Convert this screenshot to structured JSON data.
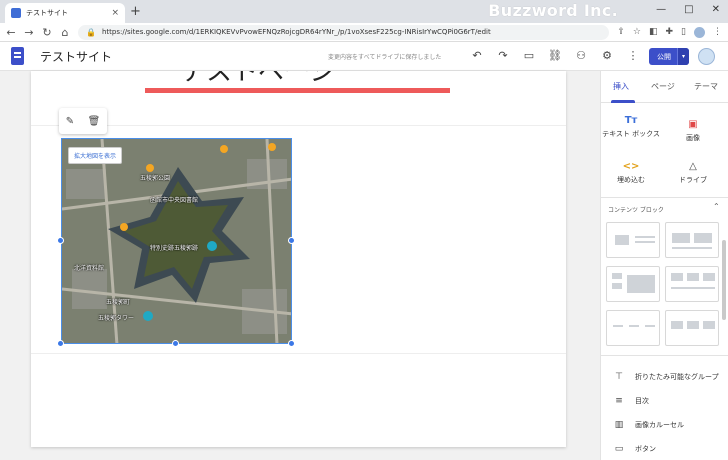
{
  "browser": {
    "tab_title": "テストサイト",
    "tab_close": "×",
    "new_tab": "+",
    "url": "https://sites.google.com/d/1ERKIQKEVvPvowEFNQzRojcgDR64rYNr_/p/1voXsesF225cg-INRisIrYwCQPi0G6rT/edit",
    "overlay_brand": "Buzzword Inc.",
    "win_minimize": "—",
    "win_maximize": "□",
    "win_close": "✕"
  },
  "app": {
    "site_title": "テストサイト",
    "draft_note": "変更内容をすべてドライブに保存しました",
    "publish_label": "公開",
    "publish_caret": "▾"
  },
  "canvas": {
    "heading_text": "テストページ"
  },
  "map": {
    "badge": "拡大地図を表示",
    "labels": [
      "五稜郭公園",
      "函館市中央図書館",
      "特別史跡五稜郭跡",
      "五稜郭町",
      "五稜郭タワー",
      "北洋資料館"
    ]
  },
  "panel": {
    "tabs": [
      "挿入",
      "ページ",
      "テーマ"
    ],
    "insert_items": [
      {
        "icon": "Tт",
        "label": "テキスト ボックス"
      },
      {
        "icon": "▣",
        "label": "画像"
      },
      {
        "icon": "<>",
        "label": "埋め込む"
      },
      {
        "icon": "△",
        "label": "ドライブ"
      }
    ],
    "content_blocks_title": "コンテンツ ブロック",
    "content_blocks_caret": "⌃",
    "list_items": [
      {
        "icon": "⊤",
        "label": "折りたたみ可能なグループ"
      },
      {
        "icon": "≡",
        "label": "目次"
      },
      {
        "icon": "▥",
        "label": "画像カルーセル"
      },
      {
        "icon": "▭",
        "label": "ボタン"
      }
    ]
  },
  "colors": {
    "brand": "#3c4fc9",
    "selection": "#3b78e7",
    "accent_red": "#ee5a5a"
  }
}
